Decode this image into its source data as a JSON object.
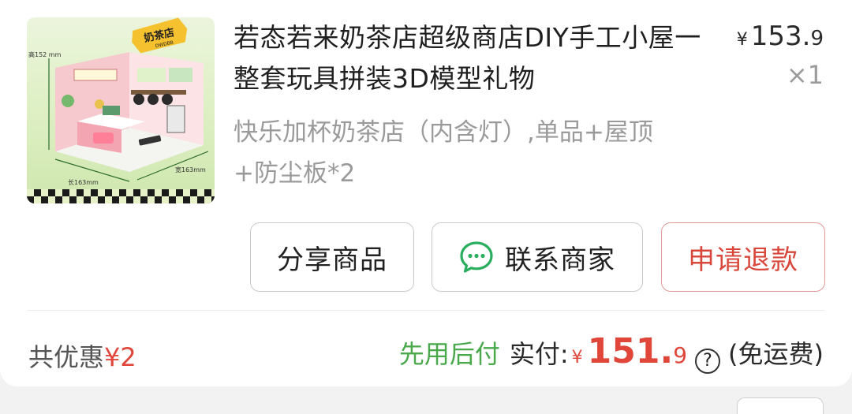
{
  "item": {
    "image_label": "奶茶店",
    "image_sublabel": "DWDBB",
    "dim_height": "高152 mm",
    "dim_length": "长163mm",
    "dim_width": "宽163mm",
    "title": "若态若来奶茶店超级商店DIY手工小屋一整套玩具拼装3D模型礼物",
    "price_currency": "¥",
    "price_int": "153.",
    "price_dec": "9",
    "quantity": "×1",
    "variant": "快乐加杯奶茶店（内含灯）,单品+屋顶+防尘板*2"
  },
  "actions": {
    "share_label": "分享商品",
    "contact_label": "联系商家",
    "refund_label": "申请退款"
  },
  "summary": {
    "discount_label": "共优惠",
    "discount_amount": "¥2",
    "pay_later": "先用后付",
    "paid_label": "实付:",
    "paid_currency": "¥",
    "paid_int": "151.",
    "paid_dec": "9",
    "help_symbol": "?",
    "shipping_note": "(免运费)"
  },
  "colors": {
    "accent_red": "#e0463a",
    "pay_later_green": "#48a84a",
    "wechat_green": "#2aae5e"
  },
  "icons": {
    "contact": "wechat-chat-bubble-icon",
    "help": "question-circle-icon"
  }
}
